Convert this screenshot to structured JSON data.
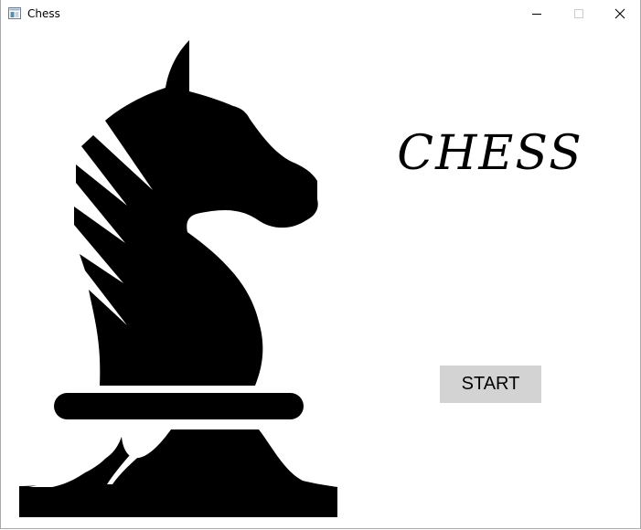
{
  "window": {
    "title": "Chess",
    "minimize_icon": "minimize-icon",
    "maximize_icon": "maximize-icon",
    "close_icon": "close-icon"
  },
  "main": {
    "game_title": "CHESS",
    "start_button_label": "START",
    "logo_icon": "knight-icon"
  },
  "colors": {
    "background": "#ffffff",
    "logo": "#000000",
    "button_background": "#d3d3d3",
    "text": "#000000"
  }
}
